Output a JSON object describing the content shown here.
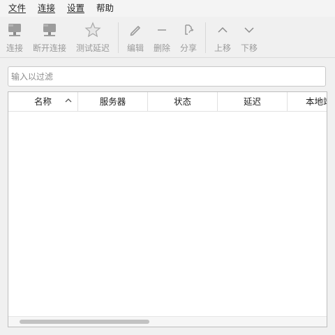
{
  "menu": {
    "file": "文件",
    "connect": "连接",
    "settings": "设置",
    "help": "帮助"
  },
  "toolbar": {
    "connect": "连接",
    "disconnect": "断开连接",
    "test_latency": "测试延迟",
    "edit": "编辑",
    "delete": "删除",
    "share": "分享",
    "move_up": "上移",
    "move_down": "下移"
  },
  "filter": {
    "placeholder": "输入以过滤",
    "value": ""
  },
  "table": {
    "columns": [
      "名称",
      "服务器",
      "状态",
      "延迟",
      "本地端口"
    ],
    "sort_column": "名称",
    "sort_direction": "ascending",
    "rows": []
  },
  "icons": {
    "connect": "server-icon",
    "disconnect": "server-icon",
    "test_latency": "star-icon",
    "edit": "pencil-icon",
    "delete": "minus-icon",
    "share": "share-icon",
    "move_up": "chevron-up-icon",
    "move_down": "chevron-down-icon"
  }
}
